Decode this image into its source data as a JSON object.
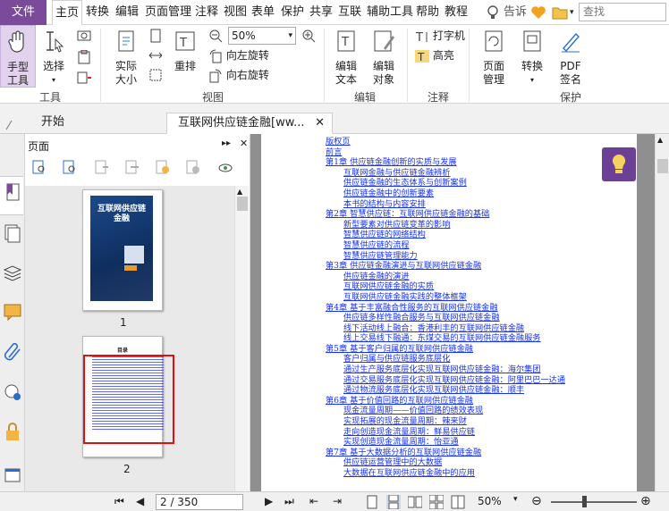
{
  "menu": {
    "file": "文件",
    "items": [
      "主页",
      "转换",
      "编辑",
      "页面管理",
      "注释",
      "视图",
      "表单",
      "保护",
      "共享",
      "互联",
      "辅助工具",
      "帮助",
      "教程"
    ],
    "tell_me": "告诉",
    "search_placeholder": "查找"
  },
  "ribbon": {
    "hand_tool": "手型\n工具",
    "select": "选择",
    "tools_group": "工具",
    "actual_size": "实际\n大小",
    "zoom_value": "50%",
    "reflow": "重排",
    "rotate_left": "向左旋转",
    "rotate_right": "向右旋转",
    "view_group": "视图",
    "edit_text": "编辑\n文本",
    "edit_object": "编辑\n对象",
    "edit_group": "编辑",
    "typewriter": "打字机",
    "highlight": "高亮",
    "comment_group": "注释",
    "page_management": "页面\n管理",
    "convert": "转换",
    "pdf_sign": "PDF\n签名",
    "protect_group": "保护"
  },
  "tabs": {
    "start": "开始",
    "doc": "互联网供应链金融[ww..."
  },
  "pages_panel": {
    "title": "页面",
    "thumb1_label": "1",
    "thumb2_label": "2",
    "book_title": "互联网供应链金融",
    "toc_heading": "目录"
  },
  "toc": [
    {
      "text": "版权页",
      "level": 0
    },
    {
      "text": "前言",
      "level": 0
    },
    {
      "text": "第1章 供应链金融创新的实质与发展",
      "level": 0
    },
    {
      "text": "互联网金融与供应链金融辨析",
      "level": 1
    },
    {
      "text": "供应链金融的生态体系与创新案例",
      "level": 1
    },
    {
      "text": "供应链金融中的创新要素",
      "level": 1
    },
    {
      "text": "本书的结构与内容安排",
      "level": 1
    },
    {
      "text": "第2章 智慧供应链：互联网供应链金融的基础",
      "level": 0
    },
    {
      "text": "新型要素对供应链变革的影响",
      "level": 1
    },
    {
      "text": "智慧供应链的网络结构",
      "level": 1
    },
    {
      "text": "智慧供应链的流程",
      "level": 1
    },
    {
      "text": "智慧供应链管理能力",
      "level": 1
    },
    {
      "text": "第3章 供应链金融演进与互联网供应链金融",
      "level": 0
    },
    {
      "text": "供应链金融的演进",
      "level": 1
    },
    {
      "text": "互联网供应链金融的实质",
      "level": 1
    },
    {
      "text": "互联网供应链金融实践的整体框架",
      "level": 1
    },
    {
      "text": "第4章 基于丰富融合性服务的互联网供应链金融",
      "level": 0
    },
    {
      "text": "供应链多样性融合服务与互联网供应链金融",
      "level": 1
    },
    {
      "text": "线下活动线上融合：香港利丰的互联网供应链金融",
      "level": 1
    },
    {
      "text": "线上交易线下融通：东煤交易的互联网供应链金融服务",
      "level": 1
    },
    {
      "text": "第5章 基于客户归属的互联网供应链金融",
      "level": 0
    },
    {
      "text": "客户归属与供应链服务底层化",
      "level": 1
    },
    {
      "text": "通过生产服务底层化实现互联网供应链金融：海尔集团",
      "level": 1
    },
    {
      "text": "通过交易服务底层化实现互联网供应链金融：阿里巴巴一达通",
      "level": 1
    },
    {
      "text": "通过物流服务底层化实现互联网供应链金融：顺丰",
      "level": 1
    },
    {
      "text": "第6章 基于价值回路的互联网供应链金融",
      "level": 0
    },
    {
      "text": "现金流量周期——价值回路的绩效表现",
      "level": 1
    },
    {
      "text": "实现拓展的现金流量周期：辣来财",
      "level": 1
    },
    {
      "text": "走向创造现金流量周期：鲜易供应链",
      "level": 1
    },
    {
      "text": "实现创造现金流量周期：怡亚通",
      "level": 1
    },
    {
      "text": "第7章 基于大数据分析的互联网供应链金融",
      "level": 0
    },
    {
      "text": "供应链运营管理中的大数据",
      "level": 1
    },
    {
      "text": "大数据在互联网供应链金融中的应用",
      "level": 1
    }
  ],
  "status": {
    "page_indicator": "2 / 350",
    "zoom": "50%"
  },
  "colors": {
    "accent": "#7b4a9b",
    "link": "#1530ff"
  }
}
